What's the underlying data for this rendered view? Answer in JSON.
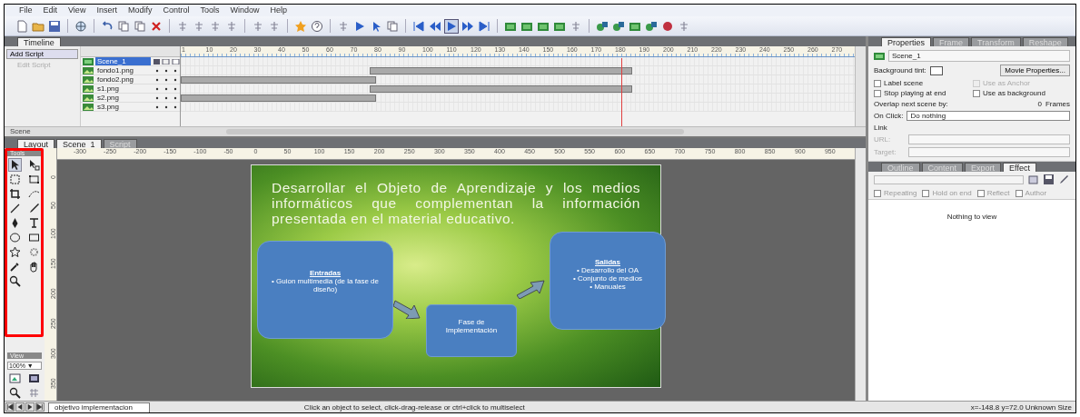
{
  "menu": [
    "File",
    "Edit",
    "View",
    "Insert",
    "Modify",
    "Control",
    "Tools",
    "Window",
    "Help"
  ],
  "timeline": {
    "tab": "Timeline",
    "add_script": "Add Script",
    "edit_script": "Edit Script",
    "scene_nav": "Scene",
    "ruler": [
      "1",
      "10",
      "20",
      "30",
      "40",
      "50",
      "60",
      "70",
      "80",
      "90",
      "100",
      "110",
      "120",
      "130",
      "140",
      "150",
      "160",
      "170",
      "180",
      "190",
      "200",
      "210",
      "220",
      "230",
      "240",
      "250",
      "260",
      "270"
    ],
    "layers": [
      {
        "name": "Scene_1",
        "kind": "scene",
        "selected": true,
        "bar_left": false,
        "bar_right": false
      },
      {
        "name": "fondo1.png",
        "kind": "object",
        "selected": false,
        "bar_left": false,
        "bar_right": true
      },
      {
        "name": "fondo2.png",
        "kind": "object",
        "selected": false,
        "bar_left": true,
        "bar_right": false
      },
      {
        "name": "s1.png",
        "kind": "object",
        "selected": false,
        "bar_left": false,
        "bar_right": true
      },
      {
        "name": "s2.png",
        "kind": "object",
        "selected": false,
        "bar_left": true,
        "bar_right": false
      },
      {
        "name": "s3.png",
        "kind": "object",
        "selected": false,
        "bar_left": false,
        "bar_right": false
      }
    ]
  },
  "layout": {
    "tabs": [
      {
        "label": "Layout",
        "selected": true
      },
      {
        "label": "Scene_1",
        "selected": true
      },
      {
        "label": "Script",
        "selected": false
      }
    ],
    "tools_title": "Tools",
    "view_title": "View",
    "zoom": "100% ▼",
    "hruler": [
      "-300",
      "-250",
      "-200",
      "-150",
      "-100",
      "-50",
      "0",
      "50",
      "100",
      "150",
      "200",
      "250",
      "300",
      "350",
      "400",
      "450",
      "500",
      "550",
      "600",
      "650",
      "700",
      "750",
      "800",
      "850",
      "900",
      "950"
    ],
    "vruler": [
      "0",
      "50",
      "100",
      "150",
      "200",
      "250",
      "300",
      "350"
    ],
    "slide": {
      "title": "Desarrollar el Objeto de Aprendizaje y los medios informáticos que complementan la información presentada en el material educativo.",
      "boxes": [
        {
          "kind": "list",
          "heading": "Entradas",
          "items": [
            "• Guion multimedia (de la fase de diseño)"
          ]
        },
        {
          "kind": "plain",
          "heading": "Fase de Implementación"
        },
        {
          "kind": "list",
          "heading": "Salidas",
          "items": [
            "• Desarrollo del OA",
            "• Conjunto de medios",
            "• Manuales"
          ]
        }
      ]
    }
  },
  "properties": {
    "tabs": [
      {
        "label": "Properties",
        "selected": true
      },
      {
        "label": "Frame",
        "selected": false
      },
      {
        "label": "Transform",
        "selected": false
      },
      {
        "label": "Reshape",
        "selected": false
      }
    ],
    "name": "Scene_1",
    "background_label": "Background tint:",
    "movie_button": "Movie Properties...",
    "options": [
      {
        "label": "Label scene",
        "checked": false,
        "disabled": false
      },
      {
        "label": "Use as Anchor",
        "checked": false,
        "disabled": true
      },
      {
        "label": "Stop playing at end",
        "checked": false,
        "disabled": false
      },
      {
        "label": "Use as background",
        "checked": false,
        "disabled": false
      }
    ],
    "overlap_label": "Overlap next scene by:",
    "overlap_value": "0",
    "overlap_unit": "Frames",
    "on_click_label": "On Click:",
    "on_click_value": "Do nothing",
    "link_label": "Link",
    "url_label": "URL:",
    "target_label": "Target:"
  },
  "effect_panel": {
    "tabs": [
      {
        "label": "Outline",
        "selected": false
      },
      {
        "label": "Content",
        "selected": false
      },
      {
        "label": "Export",
        "selected": false
      },
      {
        "label": "Effect",
        "selected": true
      }
    ],
    "options": [
      {
        "label": "Repeating",
        "checked": false
      },
      {
        "label": "Hold on end",
        "checked": false
      },
      {
        "label": "Reflect",
        "checked": false
      },
      {
        "label": "Author",
        "checked": false
      }
    ],
    "empty_message": "Nothing to view"
  },
  "status_bar": {
    "scene_tab": "objetivo implementacion",
    "hint": "Click an object to select, click-drag-release or ctrl+click to multiselect",
    "coords": "x=-148.8 y=72.0 Unknown Size"
  }
}
